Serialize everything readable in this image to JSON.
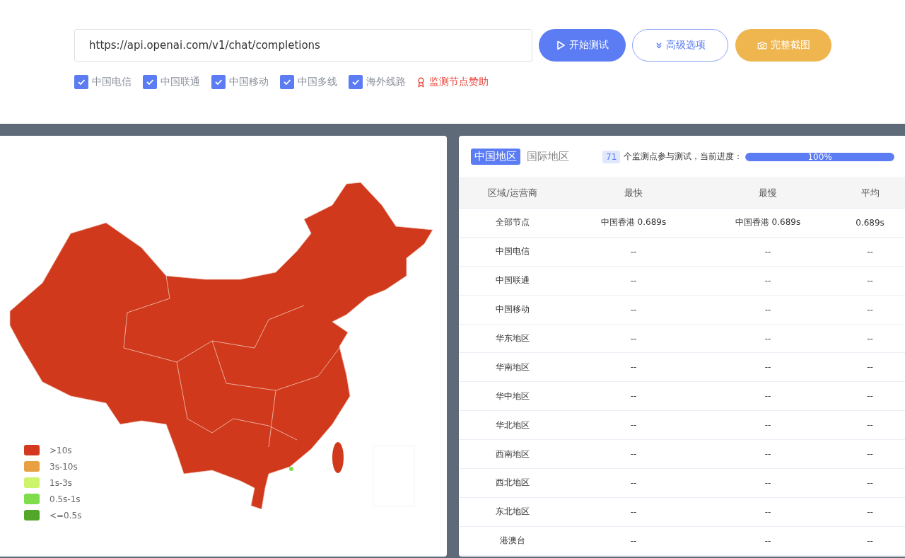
{
  "url_field": {
    "value": "https://api.openai.com/v1/chat/completions"
  },
  "buttons": [
    {
      "kind": "start",
      "label": "开始测试"
    },
    {
      "kind": "advanced",
      "label": "高级选项"
    },
    {
      "kind": "screenshot",
      "label": "完整截图"
    }
  ],
  "filters": [
    {
      "label": "中国电信",
      "checked": true
    },
    {
      "label": "中国联通",
      "checked": true
    },
    {
      "label": "中国移动",
      "checked": true
    },
    {
      "label": "中国多线",
      "checked": true
    },
    {
      "label": "海外线路",
      "checked": true
    }
  ],
  "sponsor_link": "监测节点赞助",
  "legend": [
    {
      "label": ">10s",
      "color": "#d4391f"
    },
    {
      "label": "3s-10s",
      "color": "#e8a041"
    },
    {
      "label": "1s-3s",
      "color": "#cdf46b"
    },
    {
      "label": "0.5s-1s",
      "color": "#7ddd4b"
    },
    {
      "label": "<=0.5s",
      "color": "#52a72b"
    }
  ],
  "tabs": [
    {
      "label": "中国地区",
      "selected": true
    },
    {
      "label": "国际地区",
      "selected": false
    }
  ],
  "node_count": "71",
  "progress_text": "个监测点参与测试，当前进度：",
  "progress": {
    "level": 1,
    "reading": "100%"
  },
  "table": {
    "columns": [
      "区域/运营商",
      "最快",
      "最慢",
      "平均"
    ],
    "rows": [
      [
        "全部节点",
        "中国香港 0.689s",
        "中国香港 0.689s",
        "0.689s"
      ],
      [
        "中国电信",
        "--",
        "--",
        "--"
      ],
      [
        "中国联通",
        "--",
        "--",
        "--"
      ],
      [
        "中国移动",
        "--",
        "--",
        "--"
      ],
      [
        "华东地区",
        "--",
        "--",
        "--"
      ],
      [
        "华南地区",
        "--",
        "--",
        "--"
      ],
      [
        "华中地区",
        "--",
        "--",
        "--"
      ],
      [
        "华北地区",
        "--",
        "--",
        "--"
      ],
      [
        "西南地区",
        "--",
        "--",
        "--"
      ],
      [
        "西北地区",
        "--",
        "--",
        "--"
      ],
      [
        "东北地区",
        "--",
        "--",
        "--"
      ],
      [
        "港澳台",
        "--",
        "--",
        "--"
      ]
    ]
  }
}
